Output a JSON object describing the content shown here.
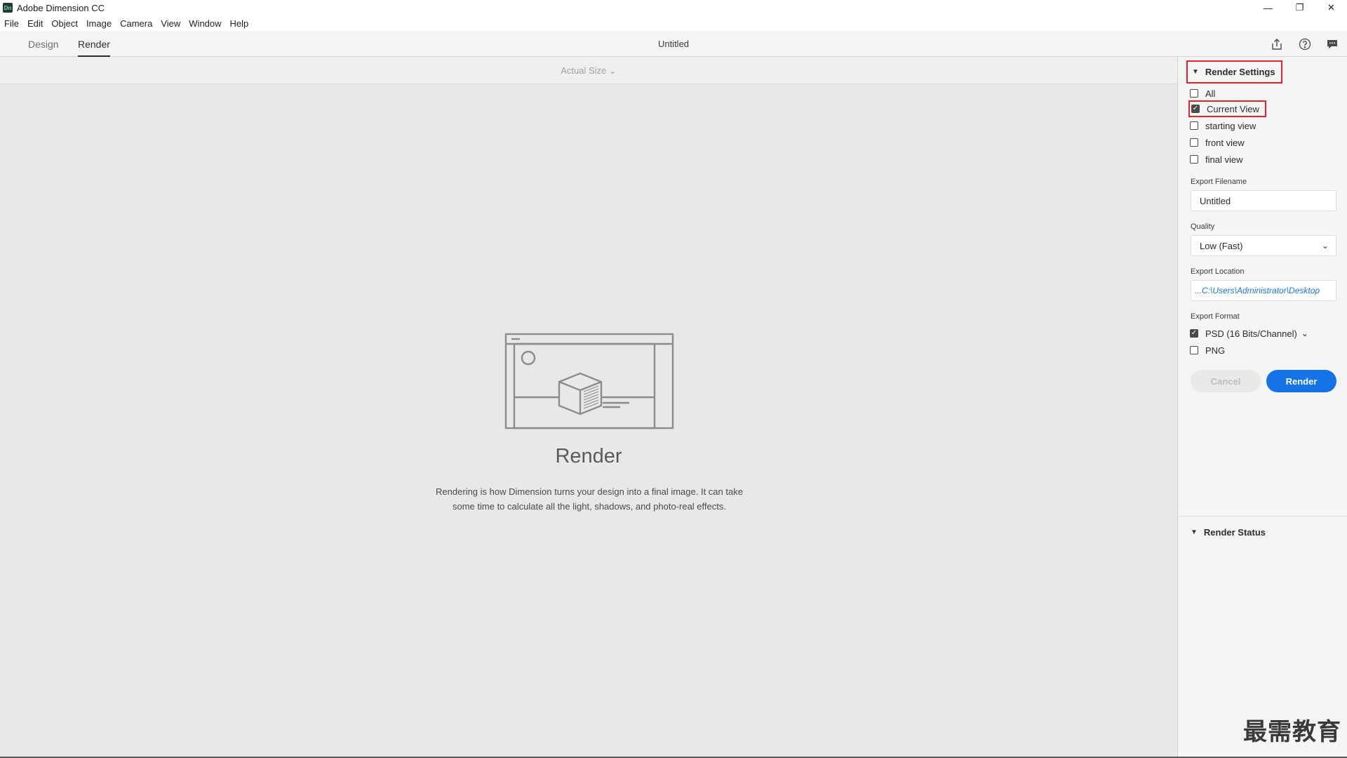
{
  "titlebar": {
    "logo_text": "Dn",
    "app_title": "Adobe Dimension CC",
    "controls": {
      "minimize": "—",
      "restore": "❐",
      "close": "✕"
    }
  },
  "menubar": {
    "items": [
      "File",
      "Edit",
      "Object",
      "Image",
      "Camera",
      "View",
      "Window",
      "Help"
    ]
  },
  "header": {
    "tabs": [
      {
        "label": "Design",
        "active": false
      },
      {
        "label": "Render",
        "active": true
      }
    ],
    "document_title": "Untitled",
    "icons": [
      "share-icon",
      "help-icon",
      "feedback-icon"
    ]
  },
  "canvas": {
    "zoom_label": "Actual Size ⌄",
    "heading": "Render",
    "description": "Rendering is how Dimension turns your design into a final image. It can take some time to calculate all the light, shadows, and photo-real effects."
  },
  "render_settings": {
    "title": "Render Settings",
    "views": [
      {
        "label": "All",
        "checked": false
      },
      {
        "label": "Current View",
        "checked": true
      },
      {
        "label": "starting view",
        "checked": false
      },
      {
        "label": "front view",
        "checked": false
      },
      {
        "label": "final view",
        "checked": false
      }
    ],
    "export_filename_label": "Export Filename",
    "export_filename_value": "Untitled",
    "quality_label": "Quality",
    "quality_value": "Low (Fast)",
    "export_location_label": "Export Location",
    "export_location_value": "...C:\\Users\\Administrator\\Desktop",
    "export_format_label": "Export Format",
    "formats": [
      {
        "label": "PSD (16 Bits/Channel)",
        "checked": true,
        "has_dropdown": true
      },
      {
        "label": "PNG",
        "checked": false,
        "has_dropdown": false
      }
    ],
    "cancel_label": "Cancel",
    "render_label": "Render"
  },
  "render_status": {
    "title": "Render Status"
  },
  "watermark": "最需教育",
  "colors": {
    "accent": "#1473e6",
    "highlight": "#e0262c",
    "panel_bg": "#f5f5f5",
    "canvas_bg": "#e8e8e8"
  }
}
